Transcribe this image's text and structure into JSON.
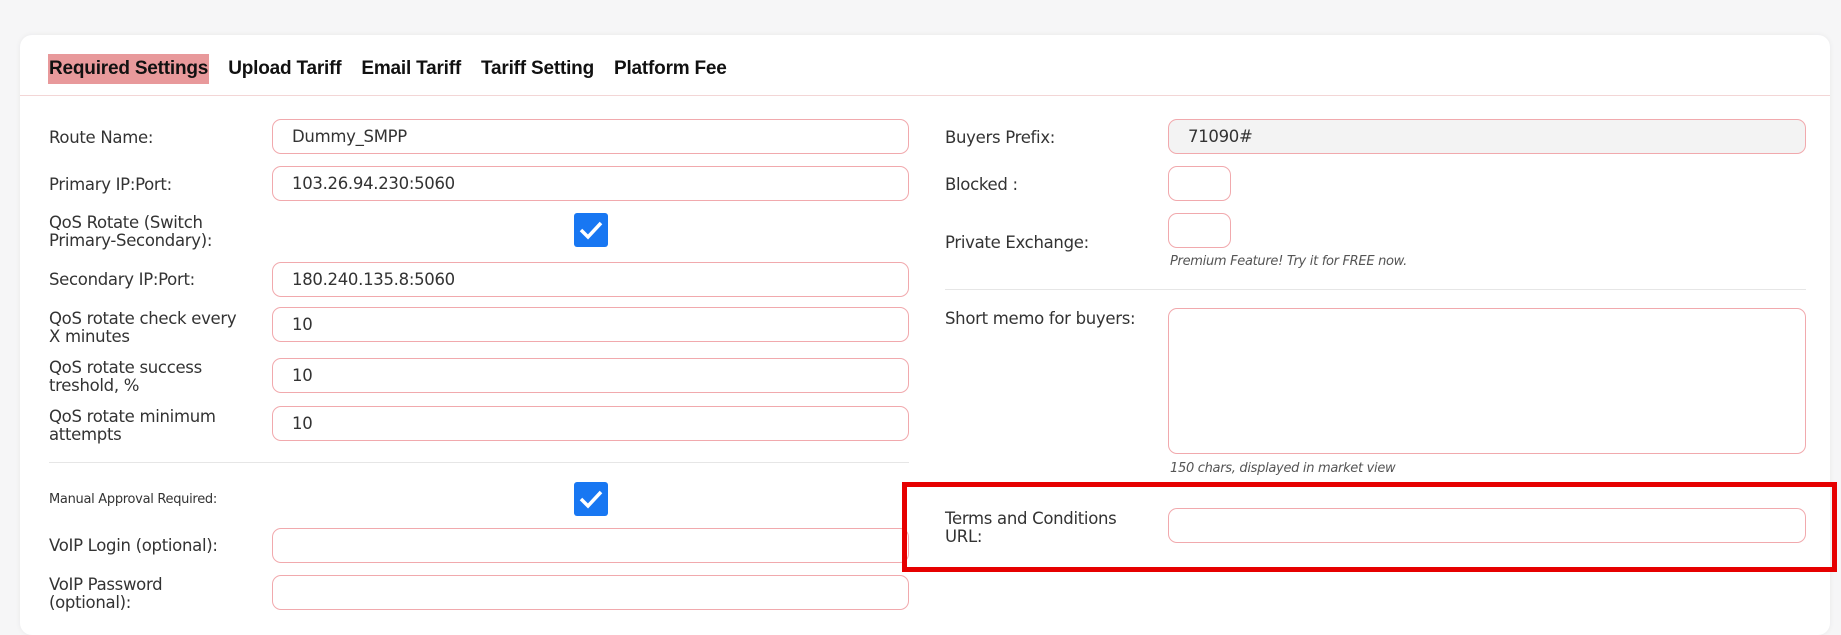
{
  "tabs": [
    {
      "label": "Required Settings",
      "active": true
    },
    {
      "label": "Upload Tariff"
    },
    {
      "label": "Email Tariff"
    },
    {
      "label": "Tariff Setting"
    },
    {
      "label": "Platform Fee"
    }
  ],
  "left": {
    "route_name": {
      "label": "Route Name:",
      "value": "Dummy_SMPP"
    },
    "primary_ip": {
      "label": "Primary IP:Port:",
      "value": "103.26.94.230:5060"
    },
    "qos_rotate": {
      "label_line1": "QoS Rotate (Switch",
      "label_line2": "Primary-Secondary):",
      "checked": true
    },
    "secondary_ip": {
      "label": "Secondary IP:Port:",
      "value": "180.240.135.8:5060"
    },
    "qos_check": {
      "label_line1": "QoS rotate check every",
      "label_line2": "X minutes",
      "value": "10"
    },
    "qos_success": {
      "label_line1": "QoS rotate success",
      "label_line2": "treshold, %",
      "value": "10"
    },
    "qos_min": {
      "label_line1": "QoS rotate minimum",
      "label_line2": "attempts",
      "value": "10"
    },
    "manual_approval": {
      "label": "Manual Approval Required:",
      "checked": true
    },
    "voip_login": {
      "label": "VoIP Login (optional):",
      "value": ""
    },
    "voip_password": {
      "label_line1": "VoIP Password",
      "label_line2": "(optional):",
      "value": ""
    }
  },
  "right": {
    "buyers_prefix": {
      "label": "Buyers Prefix:",
      "value": "71090#"
    },
    "blocked": {
      "label": "Blocked :"
    },
    "private_exchange": {
      "label": "Private Exchange:",
      "hint": "Premium Feature! Try it for FREE now."
    },
    "short_memo": {
      "label": "Short memo for buyers:",
      "hint": "150 chars, displayed in market view"
    },
    "terms_url": {
      "label_line1": "Terms and Conditions",
      "label_line2": "URL:",
      "value": ""
    }
  },
  "colors": {
    "accent": "#e8999b",
    "checkbox": "#1877f2",
    "input_border": "#f1a9ad",
    "highlight": "#e60000"
  }
}
